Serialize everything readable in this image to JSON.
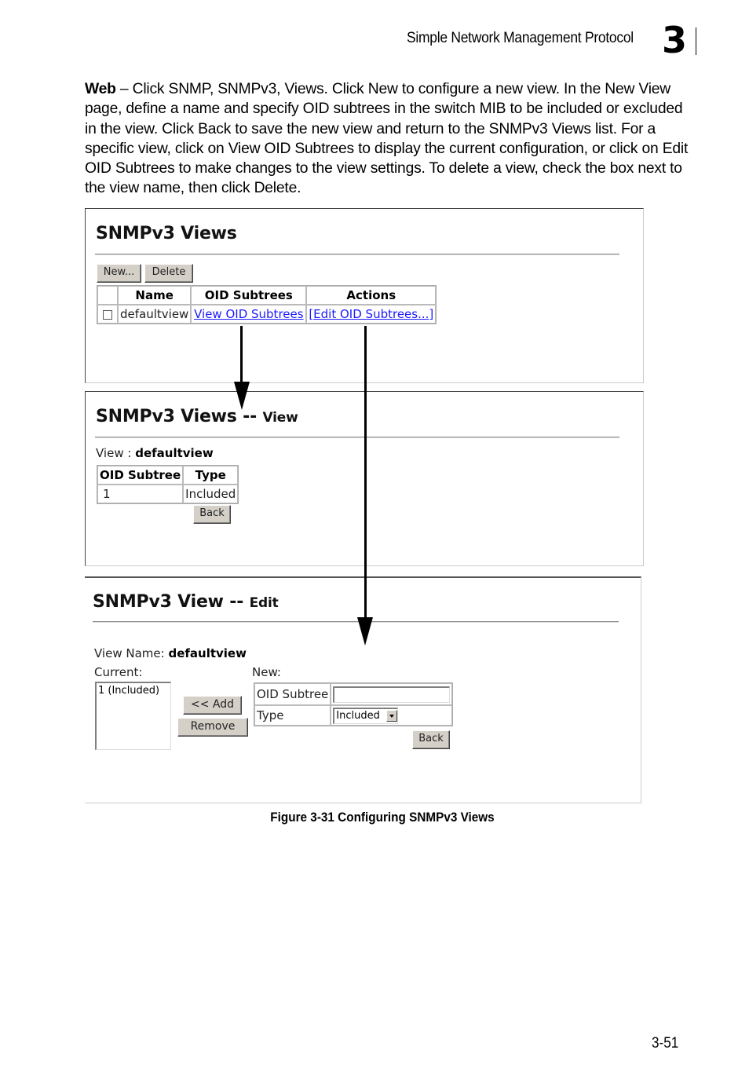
{
  "header": {
    "section_title": "Simple Network Management Protocol",
    "chapter_number": "3"
  },
  "intro": {
    "lead": "Web",
    "text": " – Click SNMP, SNMPv3, Views. Click New to configure a new view. In the New View page, define a name and specify OID subtrees in the switch MIB to be included or excluded in the view. Click Back to save the new view and return to the SNMPv3 Views list. For a specific view, click on View OID Subtrees to display the current configuration, or click on Edit OID Subtrees to make changes to the view settings. To delete a view, check the box next to the view name, then click Delete."
  },
  "views_panel": {
    "title": "SNMPv3 Views",
    "new_button": "New...",
    "delete_button": "Delete",
    "columns": [
      "",
      "Name",
      "OID Subtrees",
      "Actions"
    ],
    "rows": [
      {
        "checked": false,
        "name": "defaultview",
        "oid_link": "View OID Subtrees",
        "action_link": "[Edit OID Subtrees...]"
      }
    ]
  },
  "view_panel": {
    "title": "SNMPv3 Views --",
    "title_sub": "View",
    "view_label": "View :",
    "view_value": "defaultview",
    "columns": [
      "OID Subtree",
      "Type"
    ],
    "rows": [
      {
        "oid": "1",
        "type": "Included"
      }
    ],
    "back_button": "Back"
  },
  "edit_panel": {
    "title": "SNMPv3 View --",
    "title_sub": "Edit",
    "view_name_label": "View Name:",
    "view_name_value": "defaultview",
    "current_label": "Current:",
    "current_items": [
      "1 (Included)"
    ],
    "add_button": "<< Add",
    "remove_button": "Remove",
    "new_label": "New:",
    "oid_subtree_label": "OID Subtree",
    "oid_subtree_value": "",
    "type_label": "Type",
    "type_selected": "Included",
    "back_button": "Back"
  },
  "caption": "Figure 3-31  Configuring SNMPv3 Views",
  "page_number": "3-51"
}
